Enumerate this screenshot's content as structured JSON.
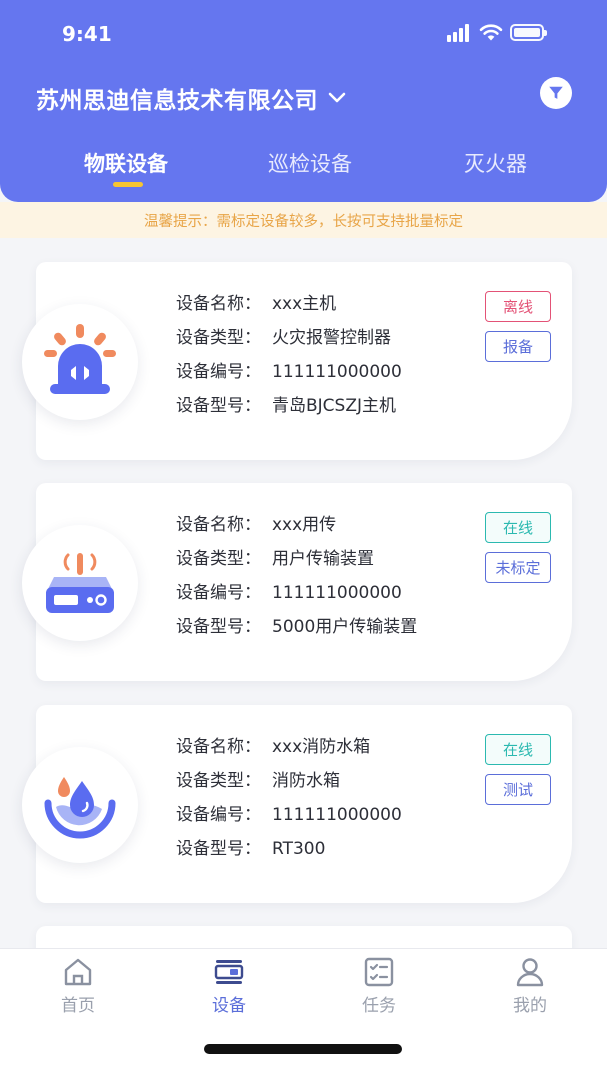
{
  "status_bar": {
    "time": "9:41"
  },
  "header": {
    "company": "苏州思迪信息技术有限公司",
    "tabs": [
      {
        "label": "物联设备",
        "active": true
      },
      {
        "label": "巡检设备",
        "active": false
      },
      {
        "label": "灭火器",
        "active": false
      }
    ]
  },
  "notice": "温馨提示：需标定设备较多，长按可支持批量标定",
  "labels": {
    "name": "设备名称：",
    "type": "设备类型：",
    "code": "设备编号：",
    "model": "设备型号："
  },
  "devices": [
    {
      "icon": "alarm-siren-icon",
      "name": "xxx主机",
      "type": "火灾报警控制器",
      "code": "111111000000",
      "model": "青岛BJCSZJ主机",
      "status": "离线",
      "action": "报备"
    },
    {
      "icon": "transmitter-device-icon",
      "name": "xxx用传",
      "type": "用户传输装置",
      "code": "111111000000",
      "model": "5000用户传输装置",
      "status": "在线",
      "action": "未标定"
    },
    {
      "icon": "water-tank-icon",
      "name": "xxx消防水箱",
      "type": "消防水箱",
      "code": "111111000000",
      "model": "RT300",
      "status": "在线",
      "action": "测试"
    }
  ],
  "tabbar": [
    {
      "label": "首页",
      "icon": "home-icon",
      "active": false
    },
    {
      "label": "设备",
      "icon": "device-icon",
      "active": true
    },
    {
      "label": "任务",
      "icon": "task-icon",
      "active": false
    },
    {
      "label": "我的",
      "icon": "profile-icon",
      "active": false
    }
  ],
  "colors": {
    "primary": "#6576ef",
    "offline": "#e35276",
    "online": "#2bb9b0",
    "action": "#5b6ed9",
    "notice_bg": "#fdf4e3",
    "notice_text": "#e8a548",
    "indicator": "#f7c531"
  }
}
